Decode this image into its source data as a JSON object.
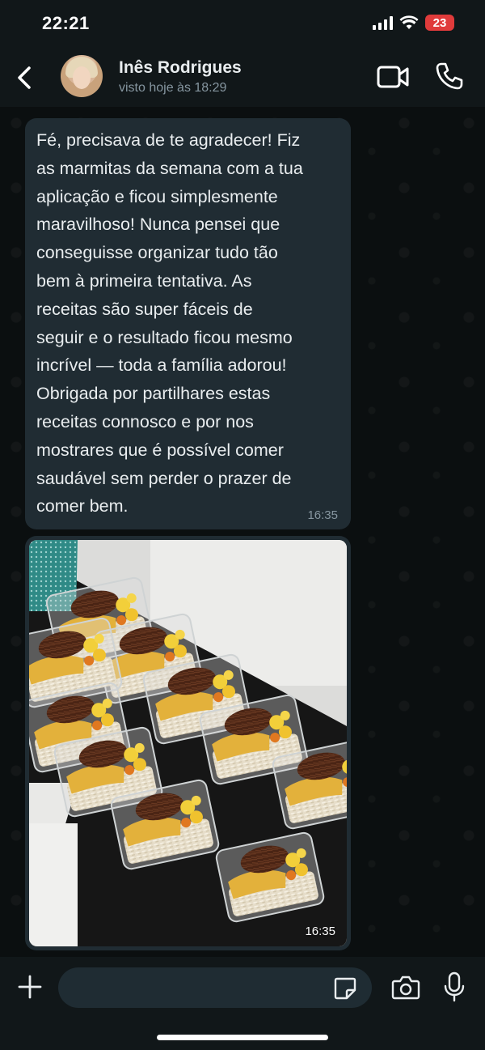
{
  "status_bar": {
    "time": "22:21",
    "battery": "23",
    "battery_color": "#e03b3b",
    "icons": [
      "signal-icon",
      "wifi-icon",
      "battery-icon"
    ]
  },
  "header": {
    "back_icon": "chevron-left-icon",
    "contact_name": "Inês Rodrigues",
    "last_seen": "visto hoje às 18:29",
    "video_icon": "video-call-icon",
    "call_icon": "phone-icon"
  },
  "messages": [
    {
      "type": "text",
      "text": "Fé, precisava de te agradecer! Fiz\nas marmitas da semana com a tua\naplicação e ficou simplesmente\nmaravilhoso! Nunca pensei que\nconseguisse organizar tudo tão\nbem à primeira tentativa. As\nreceitas são super fáceis de\nseguir e o resultado ficou mesmo\nincrível — toda a família adorou!\nObrigada por partilhares estas\nreceitas connosco e por nos\nmostrares que é possível comer\nsaudável sem perder o prazer de\ncomer bem.",
      "time": "16:35"
    },
    {
      "type": "image",
      "time": "16:35"
    }
  ],
  "input_bar": {
    "placeholder": "",
    "icons": [
      "plus-icon",
      "sticker-icon",
      "camera-icon",
      "microphone-icon"
    ]
  },
  "colors": {
    "background": "#0b0f10",
    "bubble": "#202c33",
    "text": "#e9edef",
    "muted": "#8696a0"
  }
}
